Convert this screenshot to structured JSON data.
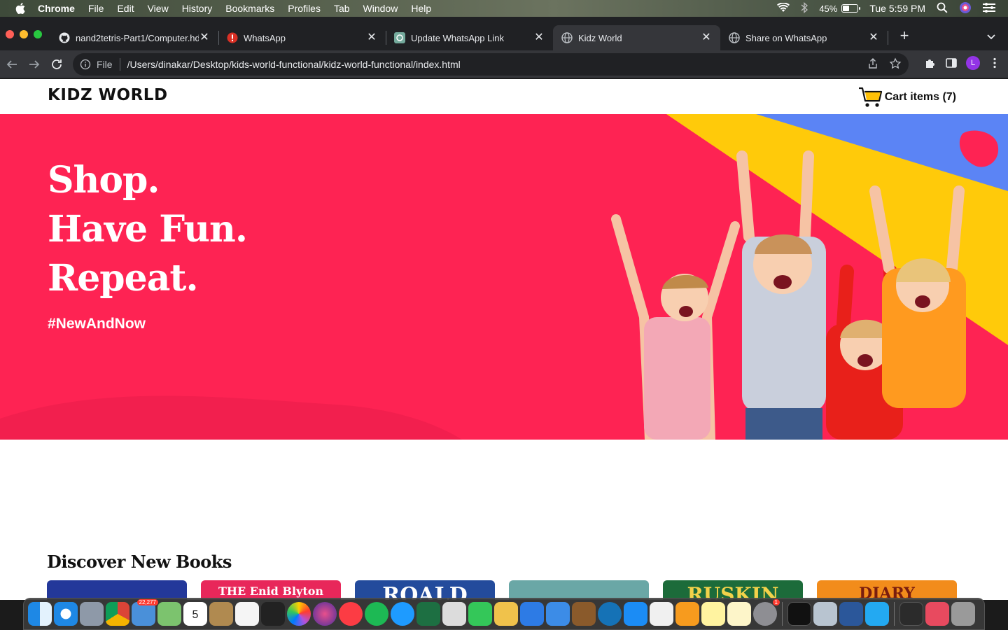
{
  "menubar": {
    "app_name": "Chrome",
    "items": [
      "File",
      "Edit",
      "View",
      "History",
      "Bookmarks",
      "Profiles",
      "Tab",
      "Window",
      "Help"
    ],
    "battery": "45%",
    "clock": "Tue 5:59 PM"
  },
  "tabs": [
    {
      "title": "nand2tetris-Part1/Computer.hd",
      "icon": "github-icon"
    },
    {
      "title": "WhatsApp",
      "icon": "alert-icon"
    },
    {
      "title": "Update WhatsApp Link",
      "icon": "openai-icon"
    },
    {
      "title": "Kidz World",
      "icon": "globe-icon",
      "active": true
    },
    {
      "title": "Share on WhatsApp",
      "icon": "globe-icon"
    }
  ],
  "omnibox": {
    "scheme": "File",
    "url": "/Users/dinakar/Desktop/kids-world-functional/kidz-world-functional/index.html"
  },
  "profile_initial": "L",
  "site": {
    "logo": "KIDZ WORLD",
    "cart_label": "Cart items (7)",
    "hero": {
      "line1": "Shop.",
      "line2": "Have Fun.",
      "line3": "Repeat.",
      "tag": "#NewAndNow"
    },
    "section_title": "Discover New Books",
    "books": [
      {
        "title": "",
        "color": "#1f3a8a"
      },
      {
        "title": "THE Enid Blyton",
        "color": "#e8275a"
      },
      {
        "title": "ROALD",
        "color": "#234b9c"
      },
      {
        "title": "",
        "color": "#6aa7a6"
      },
      {
        "title": "RUSKIN",
        "color": "#1c6b3a"
      },
      {
        "title": "DIARY",
        "color": "#f28c1b"
      }
    ]
  },
  "colors": {
    "hero_bg": "#fe2353",
    "hero_yellow": "#ffca0a",
    "hero_blue": "#5b84f5"
  }
}
